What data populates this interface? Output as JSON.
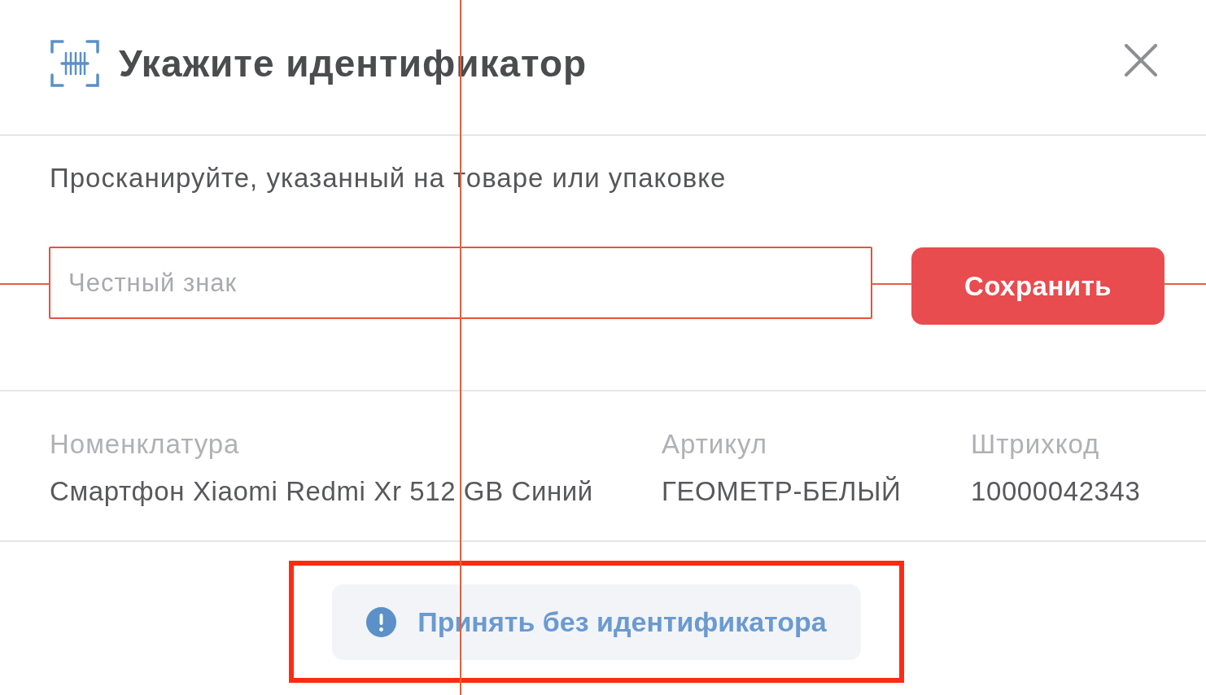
{
  "dialog": {
    "title": "Укажите идентификатор",
    "instruction": "Просканируйте, указанный на товаре или упаковке",
    "identifier_field": {
      "placeholder": "Честный знак"
    },
    "save_button": "Сохранить",
    "details": [
      {
        "label": "Номенклатура",
        "value": "Смартфон Xiaomi Redmi Xr 512 GB Синий"
      },
      {
        "label": "Артикул",
        "value": "ГЕОМЕТР-БЕЛЫЙ"
      },
      {
        "label": "Штрихкод",
        "value": "10000042343"
      }
    ],
    "accept_without_id_button": "Принять без идентификатора"
  }
}
